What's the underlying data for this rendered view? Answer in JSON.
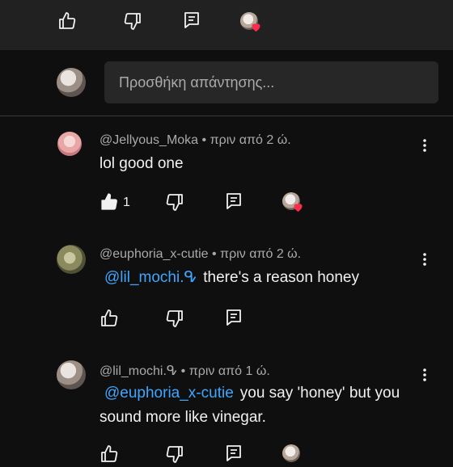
{
  "reply_box": {
    "placeholder": "Προσθήκη απάντησης..."
  },
  "comments": [
    {
      "author": "@Jellyous_Moka",
      "time": "πριν από 2 ώ.",
      "text": "lol good one",
      "likes": "1",
      "hearted": true
    },
    {
      "author": "@euphoria_x-cutie",
      "time": "πριν από 2 ώ.",
      "mention": "@lil_mochi.ᕴ",
      "text": "there's a reason honey",
      "hearted": false
    },
    {
      "author": "@lil_mochi.ᕴ",
      "time": "πριν από 1 ώ.",
      "mention": "@euphoria_x-cutie",
      "text_line1": "you say 'honey' but you",
      "text_line2": "sound more like vinegar.",
      "hearted": true
    }
  ],
  "separator": " • ",
  "colors": {
    "mention": "#3ea6ff",
    "heart": "#ff2b4a",
    "background": "#0f0f0f"
  },
  "icons": [
    "like-icon",
    "dislike-icon",
    "reply-icon",
    "more-vert-icon",
    "heart-icon"
  ]
}
